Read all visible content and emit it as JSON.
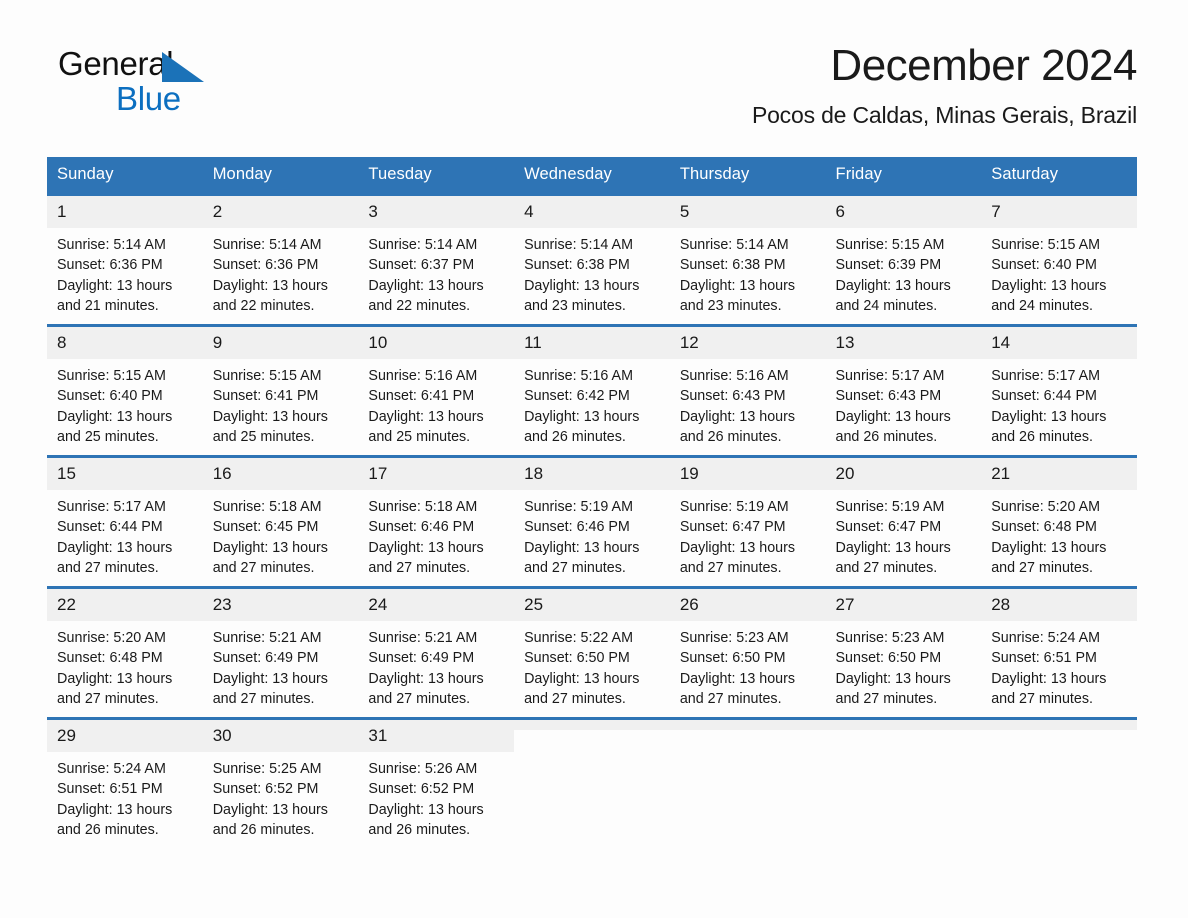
{
  "logo": {
    "word1": "General",
    "word2": "Blue",
    "triangle_color": "#1b72b8",
    "word2_color": "#0c6fc0"
  },
  "header": {
    "title": "December 2024",
    "subtitle": "Pocos de Caldas, Minas Gerais, Brazil"
  },
  "theme": {
    "header_blue": "#2e74b5",
    "daynum_gray": "#f0f0f0",
    "text": "#1a1a1a"
  },
  "weekday_headers": [
    "Sunday",
    "Monday",
    "Tuesday",
    "Wednesday",
    "Thursday",
    "Friday",
    "Saturday"
  ],
  "weeks": [
    [
      {
        "day": "1",
        "sunrise": "Sunrise: 5:14 AM",
        "sunset": "Sunset: 6:36 PM",
        "daylight1": "Daylight: 13 hours",
        "daylight2": "and 21 minutes."
      },
      {
        "day": "2",
        "sunrise": "Sunrise: 5:14 AM",
        "sunset": "Sunset: 6:36 PM",
        "daylight1": "Daylight: 13 hours",
        "daylight2": "and 22 minutes."
      },
      {
        "day": "3",
        "sunrise": "Sunrise: 5:14 AM",
        "sunset": "Sunset: 6:37 PM",
        "daylight1": "Daylight: 13 hours",
        "daylight2": "and 22 minutes."
      },
      {
        "day": "4",
        "sunrise": "Sunrise: 5:14 AM",
        "sunset": "Sunset: 6:38 PM",
        "daylight1": "Daylight: 13 hours",
        "daylight2": "and 23 minutes."
      },
      {
        "day": "5",
        "sunrise": "Sunrise: 5:14 AM",
        "sunset": "Sunset: 6:38 PM",
        "daylight1": "Daylight: 13 hours",
        "daylight2": "and 23 minutes."
      },
      {
        "day": "6",
        "sunrise": "Sunrise: 5:15 AM",
        "sunset": "Sunset: 6:39 PM",
        "daylight1": "Daylight: 13 hours",
        "daylight2": "and 24 minutes."
      },
      {
        "day": "7",
        "sunrise": "Sunrise: 5:15 AM",
        "sunset": "Sunset: 6:40 PM",
        "daylight1": "Daylight: 13 hours",
        "daylight2": "and 24 minutes."
      }
    ],
    [
      {
        "day": "8",
        "sunrise": "Sunrise: 5:15 AM",
        "sunset": "Sunset: 6:40 PM",
        "daylight1": "Daylight: 13 hours",
        "daylight2": "and 25 minutes."
      },
      {
        "day": "9",
        "sunrise": "Sunrise: 5:15 AM",
        "sunset": "Sunset: 6:41 PM",
        "daylight1": "Daylight: 13 hours",
        "daylight2": "and 25 minutes."
      },
      {
        "day": "10",
        "sunrise": "Sunrise: 5:16 AM",
        "sunset": "Sunset: 6:41 PM",
        "daylight1": "Daylight: 13 hours",
        "daylight2": "and 25 minutes."
      },
      {
        "day": "11",
        "sunrise": "Sunrise: 5:16 AM",
        "sunset": "Sunset: 6:42 PM",
        "daylight1": "Daylight: 13 hours",
        "daylight2": "and 26 minutes."
      },
      {
        "day": "12",
        "sunrise": "Sunrise: 5:16 AM",
        "sunset": "Sunset: 6:43 PM",
        "daylight1": "Daylight: 13 hours",
        "daylight2": "and 26 minutes."
      },
      {
        "day": "13",
        "sunrise": "Sunrise: 5:17 AM",
        "sunset": "Sunset: 6:43 PM",
        "daylight1": "Daylight: 13 hours",
        "daylight2": "and 26 minutes."
      },
      {
        "day": "14",
        "sunrise": "Sunrise: 5:17 AM",
        "sunset": "Sunset: 6:44 PM",
        "daylight1": "Daylight: 13 hours",
        "daylight2": "and 26 minutes."
      }
    ],
    [
      {
        "day": "15",
        "sunrise": "Sunrise: 5:17 AM",
        "sunset": "Sunset: 6:44 PM",
        "daylight1": "Daylight: 13 hours",
        "daylight2": "and 27 minutes."
      },
      {
        "day": "16",
        "sunrise": "Sunrise: 5:18 AM",
        "sunset": "Sunset: 6:45 PM",
        "daylight1": "Daylight: 13 hours",
        "daylight2": "and 27 minutes."
      },
      {
        "day": "17",
        "sunrise": "Sunrise: 5:18 AM",
        "sunset": "Sunset: 6:46 PM",
        "daylight1": "Daylight: 13 hours",
        "daylight2": "and 27 minutes."
      },
      {
        "day": "18",
        "sunrise": "Sunrise: 5:19 AM",
        "sunset": "Sunset: 6:46 PM",
        "daylight1": "Daylight: 13 hours",
        "daylight2": "and 27 minutes."
      },
      {
        "day": "19",
        "sunrise": "Sunrise: 5:19 AM",
        "sunset": "Sunset: 6:47 PM",
        "daylight1": "Daylight: 13 hours",
        "daylight2": "and 27 minutes."
      },
      {
        "day": "20",
        "sunrise": "Sunrise: 5:19 AM",
        "sunset": "Sunset: 6:47 PM",
        "daylight1": "Daylight: 13 hours",
        "daylight2": "and 27 minutes."
      },
      {
        "day": "21",
        "sunrise": "Sunrise: 5:20 AM",
        "sunset": "Sunset: 6:48 PM",
        "daylight1": "Daylight: 13 hours",
        "daylight2": "and 27 minutes."
      }
    ],
    [
      {
        "day": "22",
        "sunrise": "Sunrise: 5:20 AM",
        "sunset": "Sunset: 6:48 PM",
        "daylight1": "Daylight: 13 hours",
        "daylight2": "and 27 minutes."
      },
      {
        "day": "23",
        "sunrise": "Sunrise: 5:21 AM",
        "sunset": "Sunset: 6:49 PM",
        "daylight1": "Daylight: 13 hours",
        "daylight2": "and 27 minutes."
      },
      {
        "day": "24",
        "sunrise": "Sunrise: 5:21 AM",
        "sunset": "Sunset: 6:49 PM",
        "daylight1": "Daylight: 13 hours",
        "daylight2": "and 27 minutes."
      },
      {
        "day": "25",
        "sunrise": "Sunrise: 5:22 AM",
        "sunset": "Sunset: 6:50 PM",
        "daylight1": "Daylight: 13 hours",
        "daylight2": "and 27 minutes."
      },
      {
        "day": "26",
        "sunrise": "Sunrise: 5:23 AM",
        "sunset": "Sunset: 6:50 PM",
        "daylight1": "Daylight: 13 hours",
        "daylight2": "and 27 minutes."
      },
      {
        "day": "27",
        "sunrise": "Sunrise: 5:23 AM",
        "sunset": "Sunset: 6:50 PM",
        "daylight1": "Daylight: 13 hours",
        "daylight2": "and 27 minutes."
      },
      {
        "day": "28",
        "sunrise": "Sunrise: 5:24 AM",
        "sunset": "Sunset: 6:51 PM",
        "daylight1": "Daylight: 13 hours",
        "daylight2": "and 27 minutes."
      }
    ],
    [
      {
        "day": "29",
        "sunrise": "Sunrise: 5:24 AM",
        "sunset": "Sunset: 6:51 PM",
        "daylight1": "Daylight: 13 hours",
        "daylight2": "and 26 minutes."
      },
      {
        "day": "30",
        "sunrise": "Sunrise: 5:25 AM",
        "sunset": "Sunset: 6:52 PM",
        "daylight1": "Daylight: 13 hours",
        "daylight2": "and 26 minutes."
      },
      {
        "day": "31",
        "sunrise": "Sunrise: 5:26 AM",
        "sunset": "Sunset: 6:52 PM",
        "daylight1": "Daylight: 13 hours",
        "daylight2": "and 26 minutes."
      },
      {
        "day": "",
        "sunrise": "",
        "sunset": "",
        "daylight1": "",
        "daylight2": ""
      },
      {
        "day": "",
        "sunrise": "",
        "sunset": "",
        "daylight1": "",
        "daylight2": ""
      },
      {
        "day": "",
        "sunrise": "",
        "sunset": "",
        "daylight1": "",
        "daylight2": ""
      },
      {
        "day": "",
        "sunrise": "",
        "sunset": "",
        "daylight1": "",
        "daylight2": ""
      }
    ]
  ]
}
